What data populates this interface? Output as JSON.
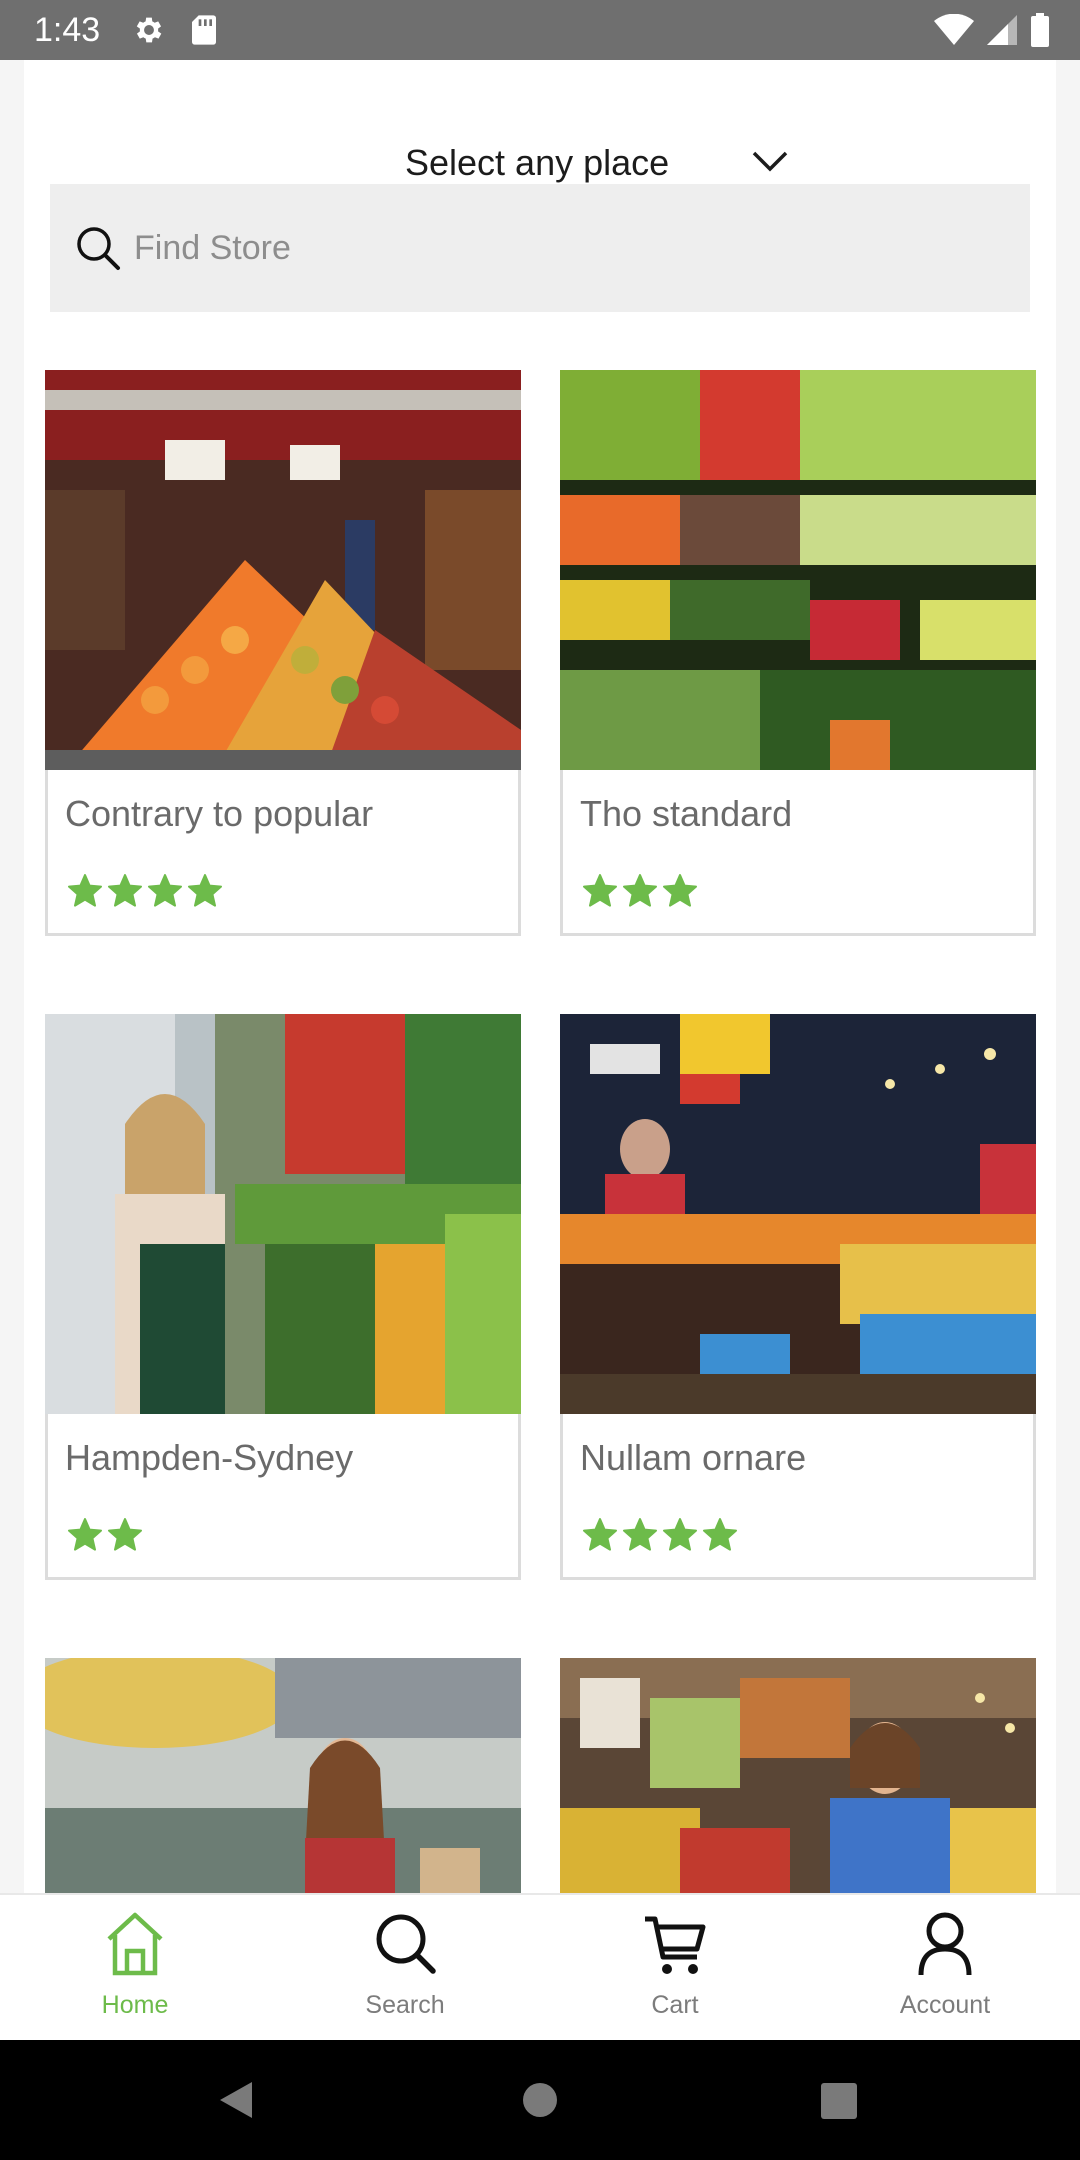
{
  "status_bar": {
    "time": "1:43",
    "icons": [
      "gear-icon",
      "sd-card-icon",
      "wifi-icon",
      "signal-icon",
      "battery-icon"
    ]
  },
  "header": {
    "place_label": "Select any place"
  },
  "search": {
    "placeholder": "Find Store",
    "value": ""
  },
  "stores": [
    {
      "name": "Contrary to popular",
      "rating": 4,
      "image": "fruit-pyramid-store"
    },
    {
      "name": "Tho standard",
      "rating": 3,
      "image": "vegetable-shelves"
    },
    {
      "name": "Hampden-Sydney",
      "rating": 2,
      "image": "woman-shopping-produce"
    },
    {
      "name": "Nullam ornare",
      "rating": 4,
      "image": "market-cashier-stalls"
    },
    {
      "name": "",
      "rating": 0,
      "image": "woman-market-hall"
    },
    {
      "name": "",
      "rating": 0,
      "image": "woman-fruit-stall"
    }
  ],
  "bottom_nav": [
    {
      "label": "Home",
      "icon": "home-icon",
      "active": true
    },
    {
      "label": "Search",
      "icon": "search-icon",
      "active": false
    },
    {
      "label": "Cart",
      "icon": "cart-icon",
      "active": false
    },
    {
      "label": "Account",
      "icon": "account-icon",
      "active": false
    }
  ],
  "colors": {
    "accent": "#6dbb4a",
    "status_bar": "#6f6f6f",
    "search_bg": "#eeeeee",
    "card_border": "#dcdcdc"
  }
}
